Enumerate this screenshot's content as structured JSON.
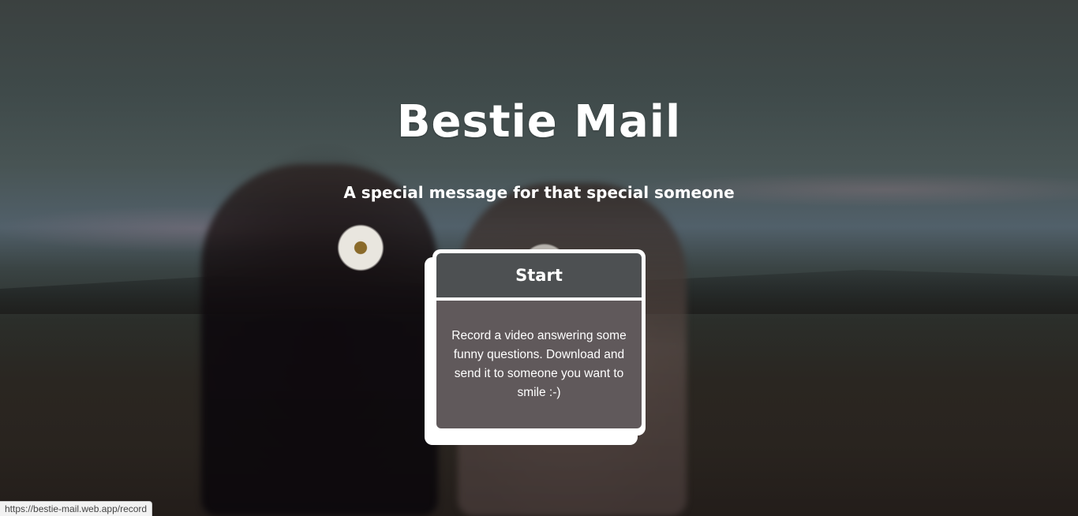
{
  "hero": {
    "title": "Bestie Mail",
    "subtitle": "A special message for that special someone"
  },
  "card": {
    "start_label": "Start",
    "description": "Record a video answering some funny questions. Download and send it to someone you want to smile :-)"
  },
  "status_bar": {
    "url": "https://bestie-mail.web.app/record"
  },
  "colors": {
    "text": "#ffffff",
    "card_border": "#ffffff",
    "card_fill": "#34383a"
  }
}
